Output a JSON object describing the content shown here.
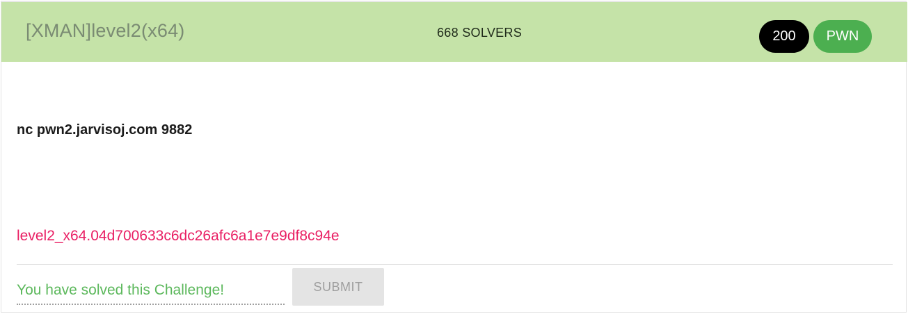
{
  "challenge": {
    "title": "[XMAN]level2(x64)",
    "solvers": "668 SOLVERS",
    "points": "200",
    "category": "PWN",
    "description": "nc pwn2.jarvisoj.com 9882",
    "attachment": "level2_x64.04d700633c6dc26afc6a1e7e9df8c94e"
  },
  "flag_form": {
    "placeholder": "You have solved this Challenge!",
    "value": "",
    "submit_label": "SUBMIT",
    "submit_disabled": true
  },
  "colors": {
    "header_bg": "#c5e3a8",
    "points_badge_bg": "#000000",
    "category_badge_bg": "#4caf50",
    "attachment_link": "#e91e63",
    "solved_text": "#5cb85c",
    "submit_bg": "#e4e4e4"
  }
}
